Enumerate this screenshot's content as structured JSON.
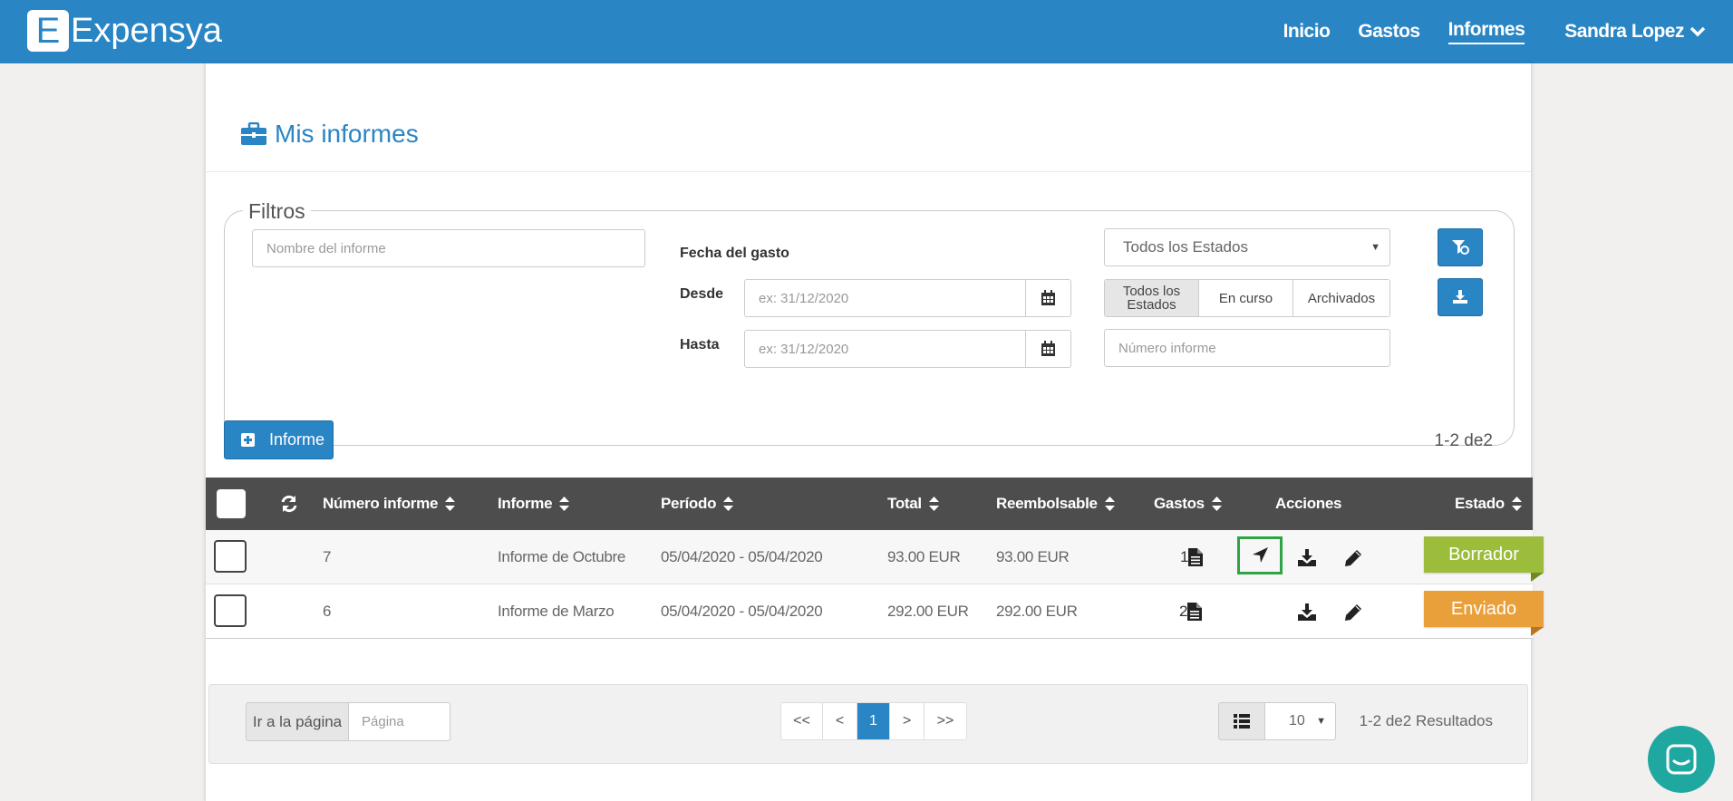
{
  "app": {
    "logo_letter": "E",
    "name": "Expensya"
  },
  "nav": {
    "items": [
      "Inicio",
      "Gastos",
      "Informes"
    ],
    "active": "Informes",
    "user": "Sandra Lopez"
  },
  "page": {
    "title": "Mis informes"
  },
  "filters": {
    "legend": "Filtros",
    "name_placeholder": "Nombre del informe",
    "date_label": "Fecha del gasto",
    "from_label": "Desde",
    "to_label": "Hasta",
    "date_placeholder": "ex: 31/12/2020",
    "status_select": "Todos los Estados",
    "status_segments": [
      "Todos los Estados",
      "En curso",
      "Archivados"
    ],
    "number_placeholder": "Número informe"
  },
  "toolbar": {
    "new_button": "Informe",
    "count": "1-2 de2"
  },
  "table": {
    "columns": [
      "Número informe",
      "Informe",
      "Período",
      "Total",
      "Reembolsable",
      "Gastos",
      "Acciones",
      "Estado"
    ],
    "rows": [
      {
        "number": "7",
        "name": "Informe de Octubre",
        "period": "05/04/2020 - 05/04/2020",
        "total": "93.00 EUR",
        "reimbursable": "93.00 EUR",
        "expenses": "1",
        "status": "Borrador",
        "status_color": "#9cbc3c",
        "status_tail": "#6f8a22"
      },
      {
        "number": "6",
        "name": "Informe de Marzo",
        "period": "05/04/2020 - 05/04/2020",
        "total": "292.00 EUR",
        "reimbursable": "292.00 EUR",
        "expenses": "2",
        "status": "Enviado",
        "status_color": "#eaa03a",
        "status_tail": "#b9741c"
      }
    ]
  },
  "pagination": {
    "goto_label": "Ir a la página",
    "goto_placeholder": "Página",
    "pages": [
      "<<",
      "<",
      "1",
      ">",
      ">>"
    ],
    "current": "1",
    "per_page": "10",
    "results": "1-2 de2 Resultados"
  },
  "colors": {
    "primary": "#2a85c5",
    "header_dark": "#4d4d4d",
    "highlight": "#2ea447",
    "chat": "#1fa8a0"
  }
}
